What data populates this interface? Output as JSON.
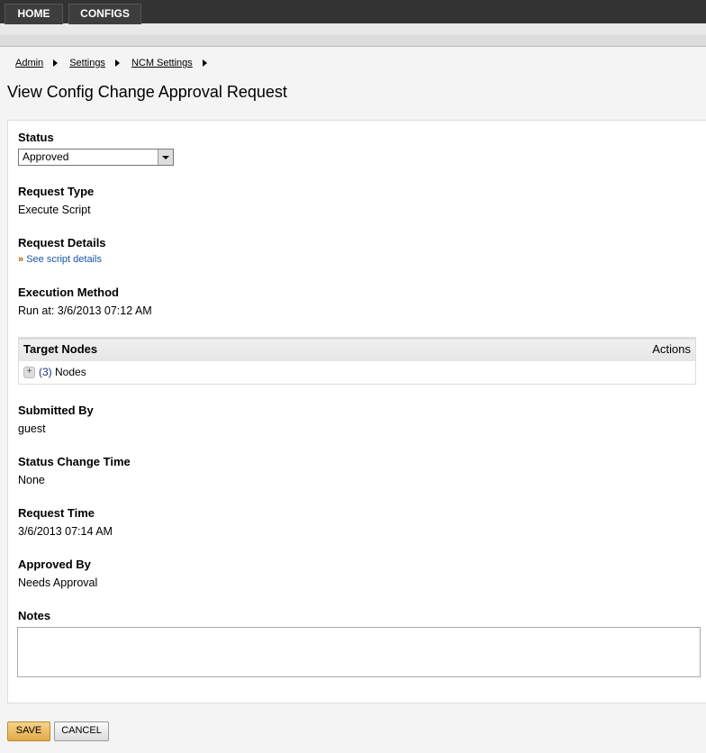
{
  "nav": {
    "tabs": [
      "HOME",
      "CONFIGS"
    ]
  },
  "breadcrumb": [
    "Admin",
    "Settings",
    "NCM Settings"
  ],
  "page_title": "View Config Change Approval Request",
  "status": {
    "label": "Status",
    "value": "Approved"
  },
  "request_type": {
    "label": "Request Type",
    "value": "Execute Script"
  },
  "request_details": {
    "label": "Request Details",
    "link_prefix": "»",
    "link": "See script details"
  },
  "execution_method": {
    "label": "Execution Method",
    "value": "Run at: 3/6/2013 07:12 AM"
  },
  "target_nodes": {
    "header": "Target Nodes",
    "actions": "Actions",
    "count": "(3)",
    "nodes_label": "Nodes"
  },
  "submitted_by": {
    "label": "Submitted By",
    "value": "guest"
  },
  "status_change_time": {
    "label": "Status Change Time",
    "value": "None"
  },
  "request_time": {
    "label": "Request Time",
    "value": "3/6/2013 07:14 AM"
  },
  "approved_by": {
    "label": "Approved By",
    "value": "Needs Approval"
  },
  "notes": {
    "label": "Notes",
    "value": ""
  },
  "buttons": {
    "save": "SAVE",
    "cancel": "CANCEL"
  }
}
